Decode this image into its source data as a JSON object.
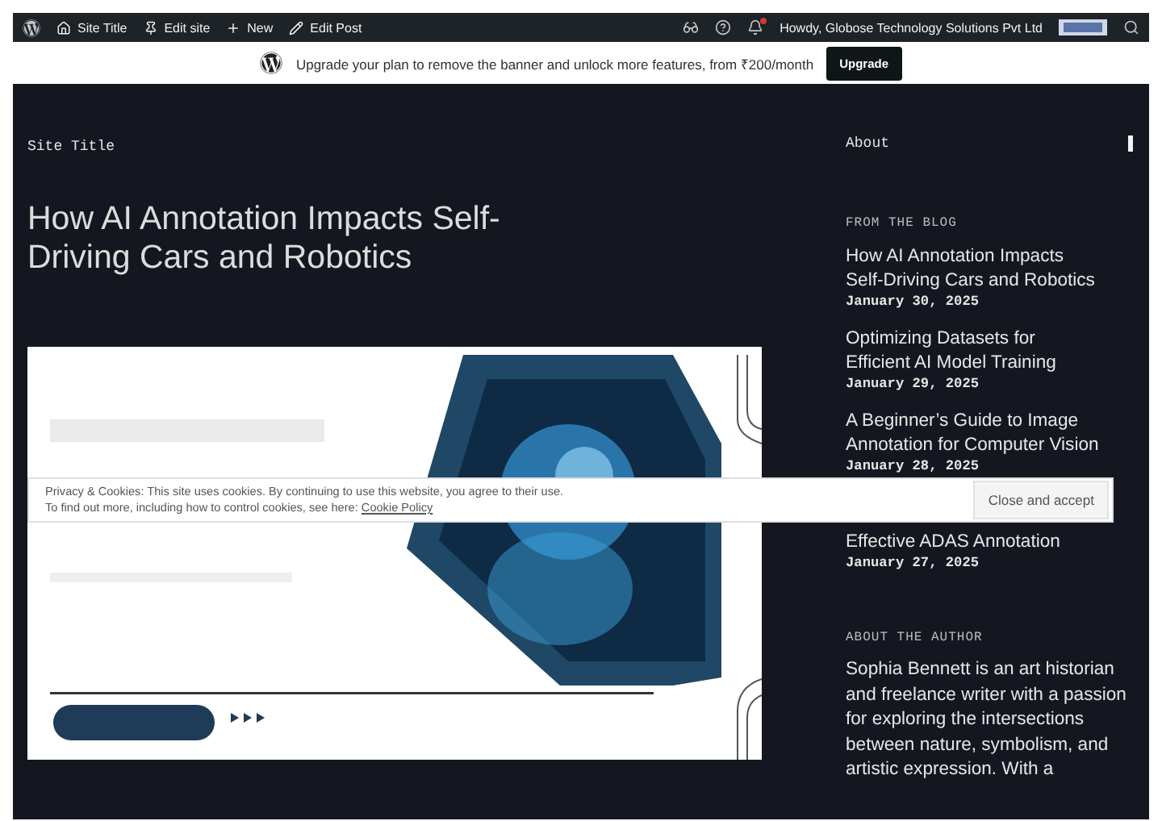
{
  "admin_bar": {
    "items": [
      {
        "kind": "home",
        "label": "Site Title"
      },
      {
        "kind": "pin",
        "label": "Edit site"
      },
      {
        "kind": "plus",
        "label": "New"
      },
      {
        "kind": "pencil",
        "label": "Edit Post"
      }
    ],
    "greeting": "Howdy, Globose Technology Solutions Pvt Ltd",
    "unread_notifications": true
  },
  "upgrade_banner": {
    "text": "Upgrade your plan to remove the banner and unlock more features, from ₹200/month",
    "button": "Upgrade"
  },
  "header": {
    "site_title": "Site Title",
    "nav": "About"
  },
  "post": {
    "title": "How AI Annotation Impacts Self-Driving Cars and Robotics"
  },
  "sidebar": {
    "blog_heading": "FROM THE BLOG",
    "posts": [
      {
        "title": "How AI Annotation Impacts Self-Driving Cars and Robotics",
        "date": "January 30, 2025"
      },
      {
        "title": "Optimizing Datasets for Efficient AI Model Training",
        "date": "January 29, 2025"
      },
      {
        "title": "A Beginner’s Guide to Image Annotation for Computer Vision",
        "date": "January 28, 2025"
      },
      {
        "title": "Effective ADAS Annotation",
        "date": "January 27, 2025"
      }
    ],
    "author_heading": "ABOUT THE AUTHOR",
    "author_bio": "Sophia Bennett is an art historian and freelance writer with a passion for exploring the intersections between nature, symbolism, and artistic expression. With a"
  },
  "cookie_banner": {
    "line_1": "Privacy & Cookies: This site uses cookies. By continuing to use this website, you agree to their use.",
    "line_2": "To find out more, including how to control cookies, see here:",
    "link": "Cookie Policy",
    "button": "Close and accept"
  }
}
